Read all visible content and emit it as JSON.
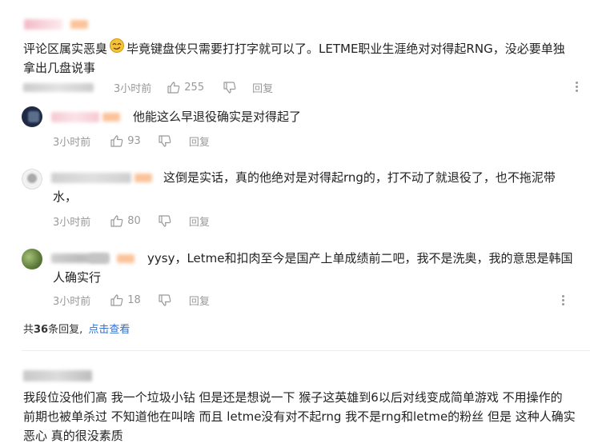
{
  "comment1": {
    "text_a": "评论区属实恶臭",
    "text_b": "毕竟键盘侠只需要打打字就可以了。LETME职业生涯绝对对得起RNG，没必要单独",
    "text_c": "拿出几盘说事",
    "time": "3小时前",
    "likes": "255",
    "reply": "回复"
  },
  "replies": [
    {
      "text_lines": [
        "他能这么早退役确实是对得起了"
      ],
      "time": "3小时前",
      "likes": "93",
      "reply": "回复"
    },
    {
      "text_lines": [
        "这倒是实话，真的他绝对是对得起rng的，打不动了就退役了，也不拖泥带",
        "水，"
      ],
      "time": "3小时前",
      "likes": "80",
      "reply": "回复"
    },
    {
      "text_lines": [
        "yysy，Letme和扣肉至今是国产上单成绩前二吧，我不是洗奥，我的意思是韩国",
        "人确实行"
      ],
      "time": "3小时前",
      "likes": "18",
      "reply": "回复"
    }
  ],
  "summary": {
    "prefix": "共",
    "count": "36",
    "suffix": "条回复,",
    "link": "点击查看"
  },
  "comment2": {
    "text_lines": [
      "我段位没他们高 我一个垃圾小钻 但是还是想说一下 猴子这英雄到6以后对线变成简单游戏 不用操作的",
      "前期也被单杀过 不知道他在叫啥 而且 letme没有对不起rng 我不是rng和letme的粉丝 但是 这种人确实",
      "恶心 真的很没素质"
    ]
  },
  "colors": {
    "link": "#2f6fd6",
    "meta": "#999999",
    "text": "#222222"
  }
}
